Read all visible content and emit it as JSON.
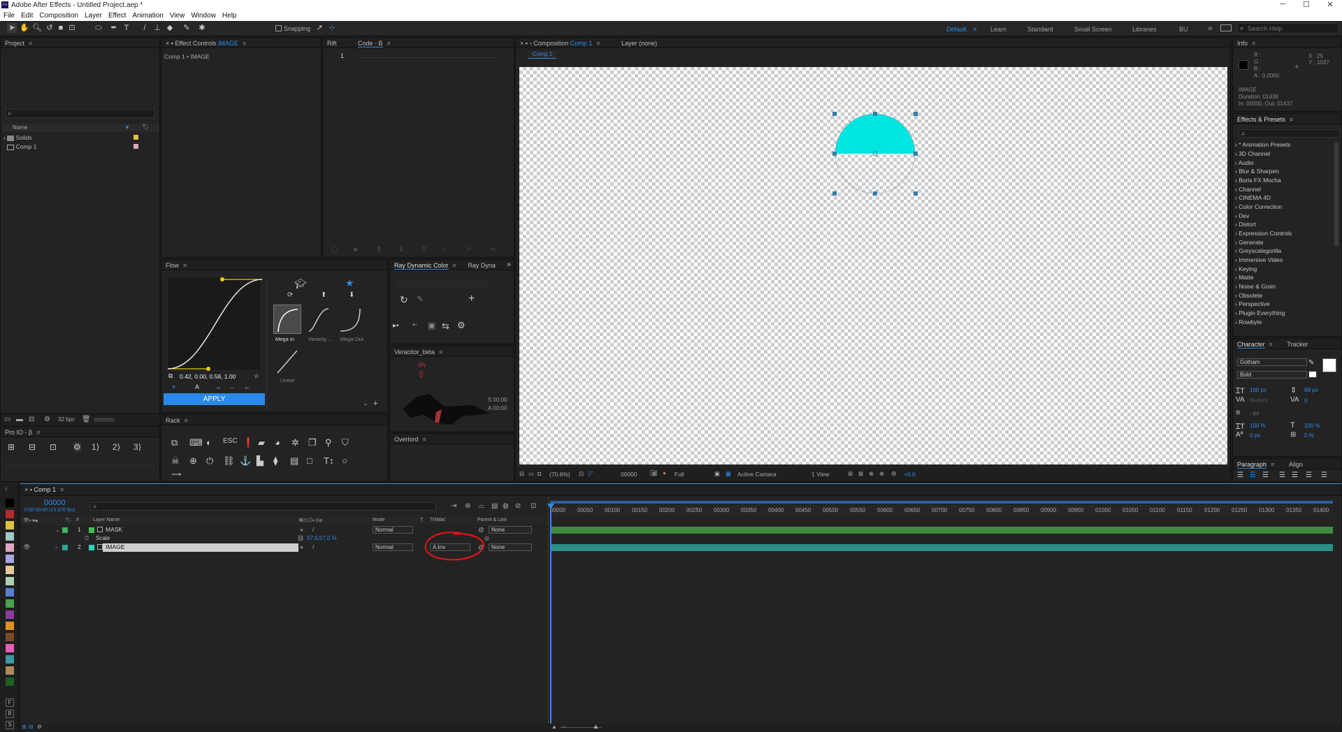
{
  "window": {
    "title": "Adobe After Effects - Untitled Project.aep *",
    "minimize": "─",
    "maximize": "☐",
    "close": "✕"
  },
  "menu": [
    "File",
    "Edit",
    "Composition",
    "Layer",
    "Effect",
    "Animation",
    "View",
    "Window",
    "Help"
  ],
  "toolbar": {
    "snapping_label": "Snapping",
    "workspaces": [
      "Default",
      "Learn",
      "Standard",
      "Small Screen",
      "Libraries",
      "BU"
    ],
    "more": "»",
    "search_placeholder": "Search Help"
  },
  "project": {
    "tab": "Project",
    "col_name": "Name",
    "items": [
      {
        "name": "Solids"
      },
      {
        "name": "Comp 1"
      }
    ],
    "bpc": "32 bpc"
  },
  "effect_controls": {
    "tab_prefix": "Effect Controls",
    "tab_layer": "IMAGE",
    "breadcrumb": "Comp 1 • IMAGE"
  },
  "code_panel": {
    "tab1": "Rift",
    "tab2": "Code - B",
    "line1": "1"
  },
  "flow": {
    "tab": "Flow",
    "values": "0.42, 0.00, 0.58, 1.00",
    "apply": "APPLY",
    "presets": [
      {
        "label": "Mega In"
      },
      {
        "label": "Veracity ..."
      },
      {
        "label": "Mega Out"
      },
      {
        "label": "Linear"
      }
    ],
    "minus": "-",
    "plus": "+"
  },
  "ray_dynamic": {
    "tab1": "Ray Dynamic Color",
    "tab2": "Ray Dyna",
    "more": "»"
  },
  "veracitor": {
    "tab": "Veracitor_beta",
    "line1": "!Pr",
    "line2": "[]",
    "s_time": "S 00:00",
    "a_time": "A 00:00"
  },
  "overlord": {
    "tab": "Overlord"
  },
  "rack": {
    "tab": "Rack"
  },
  "proio": {
    "tab": "Pro IO - β"
  },
  "composition": {
    "tab_prefix": "Composition",
    "tab_name": "Comp 1",
    "layer_tab": "Layer (none)",
    "sub_tab": "Comp 1",
    "shape_color": "#00e5e0",
    "footer": {
      "zoom": "(70.6%)",
      "time": "00000",
      "resolution": "Full",
      "camera": "Active Camera",
      "view": "1 View",
      "exposure": "+0.0"
    }
  },
  "info": {
    "tab": "Info",
    "r": "R :",
    "g": "G :",
    "b": "B :",
    "a": "A : 0.0000",
    "x": "X : 25",
    "y": "Y : 1037",
    "name": "IMAGE",
    "duration": "Duration: 01438",
    "inout": "In: 00000, Out: 01437"
  },
  "effects": {
    "tab": "Effects & Presets",
    "items": [
      "* Animation Presets",
      "3D Channel",
      "Audio",
      "Blur & Sharpen",
      "Boris FX Mocha",
      "Channel",
      "CINEMA 4D",
      "Color Correction",
      "Dev",
      "Distort",
      "Expression Controls",
      "Generate",
      "Greyscalegorilla",
      "Immersive Video",
      "Keying",
      "Matte",
      "Noise & Grain",
      "Obsolete",
      "Perspective",
      "Plugin Everything",
      "Rowbyte"
    ]
  },
  "character": {
    "tab1": "Character",
    "tab2": "Tracker",
    "font": "Gotham",
    "style": "Bold",
    "size": "100 px",
    "leading": "88 px",
    "kerning": "Metrics",
    "tracking": "0",
    "stroke": "- px",
    "vscale": "100 %",
    "hscale": "100 %",
    "baseline": "0 px",
    "tsume": "0 %"
  },
  "paragraph": {
    "tab1": "Paragraph",
    "tab2": "Align"
  },
  "timeline": {
    "tab": "Comp 1",
    "time": "00000",
    "fps": "0:00:00:00 (23.976 fps)",
    "col_layer": "Layer Name",
    "col_mode": "Mode",
    "col_t": "T",
    "col_trkmat": "TrkMat",
    "col_parent": "Parent & Link",
    "ticks": [
      "00000",
      "00050",
      "00100",
      "00150",
      "00200",
      "00250",
      "00300",
      "00350",
      "00400",
      "00450",
      "00500",
      "00550",
      "00600",
      "00650",
      "00700",
      "00750",
      "00800",
      "00850",
      "00900",
      "00950",
      "01000",
      "01050",
      "01100",
      "01150",
      "01200",
      "01250",
      "01300",
      "01350",
      "01400"
    ],
    "layers": [
      {
        "num": "1",
        "name": "MASK",
        "mode": "Normal",
        "trkmat": "",
        "parent": "None",
        "color": "#3db65b"
      },
      {
        "num": "2",
        "name": "IMAGE",
        "mode": "Normal",
        "trkmat": "A.Inv",
        "parent": "None",
        "color": "#2aa59b"
      }
    ],
    "scale_label": "Scale",
    "scale_value": "57.0,57.0 %",
    "track_mask_color": "#3f8a3f",
    "track_image_color": "#2d8f88",
    "annotation_color": "#e0141a"
  },
  "label_colors": [
    "#b32b2b",
    "#e0c33c",
    "#9fc9c5",
    "#e1a6c1",
    "#a7a6de",
    "#e8c79b",
    "#b1d0b0",
    "#577ecf",
    "#4aa24a",
    "#8b3c9b",
    "#e0921c",
    "#7b4b25",
    "#e45fb6",
    "#3b9aa3",
    "#a88a5c",
    "#1f5f1f"
  ],
  "side_letters": [
    "F",
    "B",
    "S"
  ]
}
